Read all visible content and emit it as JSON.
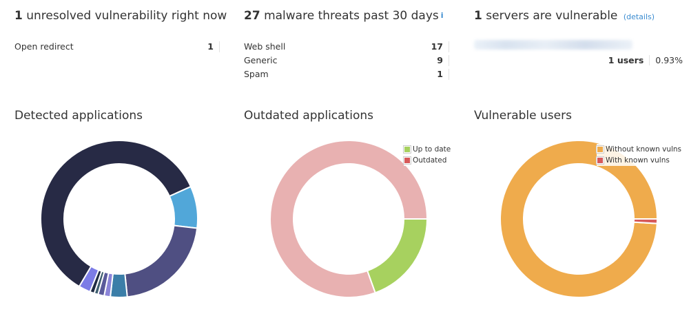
{
  "summary": {
    "vulns": {
      "count": "1",
      "text": "unresolved vulnerability right now",
      "items": [
        {
          "label": "Open redirect",
          "value": "1"
        }
      ]
    },
    "malware": {
      "count": "27",
      "text": "malware threats past 30 days",
      "info_icon": "i",
      "items": [
        {
          "label": "Web shell",
          "value": "17"
        },
        {
          "label": "Generic",
          "value": "9"
        },
        {
          "label": "Spam",
          "value": "1"
        }
      ]
    },
    "servers": {
      "count": "1",
      "text": "servers are vulnerable",
      "details_link": "(details)",
      "users_count": "1 users",
      "users_pct": "0.93%"
    }
  },
  "charts": {
    "detected": {
      "title": "Detected applications"
    },
    "outdated": {
      "title": "Outdated applications",
      "legend": [
        {
          "label": "Up to date",
          "color": "#a7d15f"
        },
        {
          "label": "Outdated",
          "color": "#d75a5a"
        }
      ]
    },
    "vulnerable": {
      "title": "Vulnerable users",
      "legend": [
        {
          "label": "Without known vulns",
          "color": "#efab4c"
        },
        {
          "label": "With known vulns",
          "color": "#d75a5a"
        }
      ]
    }
  },
  "chart_data": [
    {
      "type": "pie",
      "title": "Detected applications",
      "values": [
        51.8,
        7.5,
        18.6,
        3.0,
        1.1,
        1.1,
        0.7,
        0.8,
        2.1
      ],
      "colors": [
        "#272a45",
        "#51a7d9",
        "#4f4f82",
        "#3b7ea8",
        "#8b84d8",
        "#5a5a9a",
        "#3f5f70",
        "#1f2b44",
        "#7c7ce6"
      ]
    },
    {
      "type": "pie",
      "title": "Outdated applications",
      "values": [
        19.5,
        80.5
      ],
      "colors": [
        "#a7d15f",
        "#e8b1b1"
      ]
    },
    {
      "type": "pie",
      "title": "Vulnerable users",
      "values": [
        99.07,
        0.93
      ],
      "colors": [
        "#efab4c",
        "#d75a5a"
      ]
    }
  ]
}
